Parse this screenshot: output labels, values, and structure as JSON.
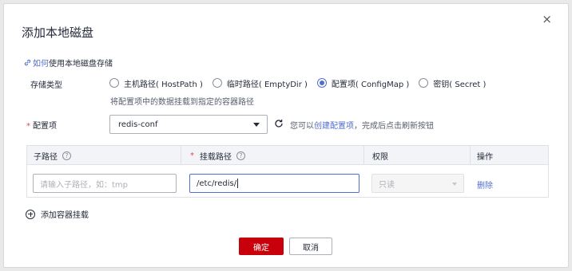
{
  "dialog": {
    "title": "添加本地磁盘",
    "close_glyph": "×"
  },
  "help": {
    "link_text": "如何",
    "text": "使用本地磁盘存储"
  },
  "storage_type": {
    "label": "存储类型",
    "options": [
      {
        "label": "主机路径( HostPath )",
        "checked": false
      },
      {
        "label": "临时路径( EmptyDir )",
        "checked": false
      },
      {
        "label": "配置项( ConfigMap )",
        "checked": true
      },
      {
        "label": "密钥( Secret )",
        "checked": false
      }
    ],
    "hint": "将配置项中的数据挂载到指定的容器路径"
  },
  "config_item": {
    "required_mark": "*",
    "label": "配置项",
    "selected": "redis-conf",
    "tip_prefix": "您可以",
    "tip_link": "创建配置项",
    "tip_suffix": "，完成后点击刷新按钮"
  },
  "table": {
    "headers": {
      "subpath": "子路径",
      "mount_required": "*",
      "mount_path": "挂载路径",
      "permission": "权限",
      "action": "操作"
    },
    "row": {
      "subpath_placeholder": "请输入子路径，如：tmp",
      "mount_path_value": "/etc/redis/",
      "permission_value": "只读",
      "delete_label": "删除"
    }
  },
  "add_mount": {
    "label": "添加容器挂载"
  },
  "footer": {
    "confirm_label": "确定",
    "cancel_label": "取消"
  },
  "colors": {
    "primary": "#c7000b",
    "link": "#526ecc",
    "required": "#e04b4b"
  }
}
